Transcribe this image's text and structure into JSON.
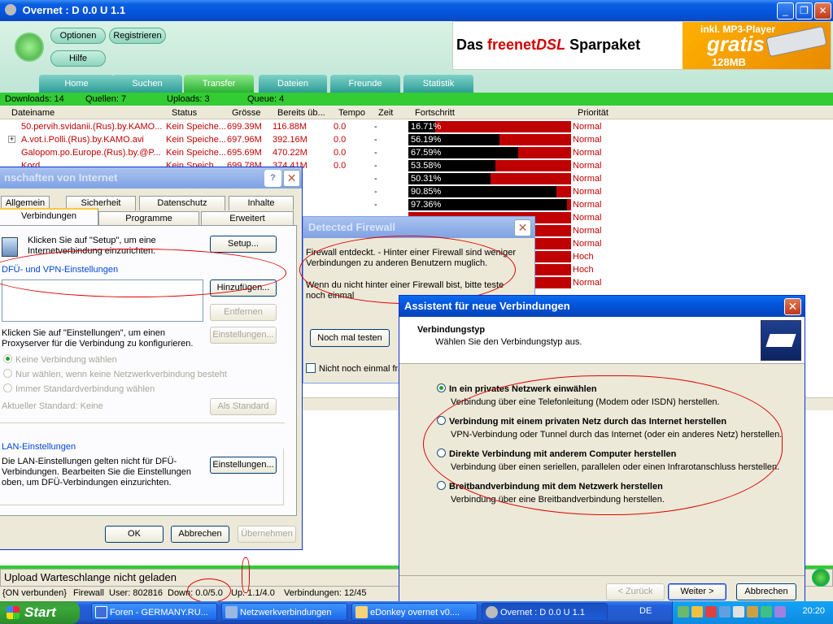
{
  "main_window": {
    "title": "Overnet : D 0.0 U 1.1",
    "buttons": {
      "options": "Optionen",
      "register": "Registrieren",
      "help": "Hilfe"
    },
    "banner": {
      "headline_pre": "Das ",
      "headline_brand": "freenet",
      "headline_brand2": "DSL",
      "headline_post": " Sparpaket",
      "promo_top": "inkl. MP3-Player",
      "promo_main": "gratis",
      "promo_sub": "128MB"
    },
    "nav": [
      "Home",
      "Suchen",
      "Transfer",
      "Dateien",
      "Freunde",
      "Statistik"
    ],
    "stats": {
      "downloads": "Downloads: 14",
      "sources": "Quellen: 7",
      "uploads": "Uploads: 3",
      "queue": "Queue: 4"
    },
    "columns": [
      "Dateiname",
      "Status",
      "Grösse",
      "Bereits üb...",
      "Tempo",
      "Zeit",
      "Fortschritt",
      "Priorität"
    ],
    "rows": [
      {
        "name": "50.pervih.svidanii.(Rus).by.KAMO...",
        "status": "Kein Speiche...",
        "size": "699.39M",
        "done": "116.88M",
        "speed": "0.0",
        "time": "-",
        "progress": "16.71%",
        "progress_value": 16.71,
        "priority": "Normal"
      },
      {
        "name": "A.vot.i.Polli.(Rus).by.KAMO.avi",
        "status": "Kein Speiche...",
        "size": "697.96M",
        "done": "392.16M",
        "speed": "0.0",
        "time": "-",
        "progress": "56.19%",
        "progress_value": 56.19,
        "priority": "Normal"
      },
      {
        "name": "Galopom.po.Europe.(Rus).by.@P...",
        "status": "Kein Speiche...",
        "size": "695.69M",
        "done": "470.22M",
        "speed": "0.0",
        "time": "-",
        "progress": "67.59%",
        "progress_value": 67.59,
        "priority": "Normal"
      },
      {
        "name": "Kord...",
        "status": "Kein Speich...",
        "size": "699.78M",
        "done": "374.41M",
        "speed": "0.0",
        "time": "-",
        "progress": "53.58%",
        "progress_value": 53.58,
        "priority": "Normal"
      },
      {
        "name": "",
        "status": "",
        "size": "",
        "done": "",
        "speed": "",
        "time": "-",
        "progress": "50.31%",
        "progress_value": 50.31,
        "priority": "Normal"
      },
      {
        "name": "",
        "status": "",
        "size": "",
        "done": "",
        "speed": "",
        "time": "-",
        "progress": "90.85%",
        "progress_value": 90.85,
        "priority": "Normal"
      },
      {
        "name": "",
        "status": "",
        "size": "",
        "done": "",
        "speed": "",
        "time": "-",
        "progress": "97.36%",
        "progress_value": 97.36,
        "priority": "Normal"
      },
      {
        "name": "",
        "status": "",
        "size": "",
        "done": "",
        "speed": "",
        "time": "",
        "progress": "",
        "progress_value": 0,
        "priority": "Normal"
      },
      {
        "name": "",
        "status": "",
        "size": "",
        "done": "",
        "speed": "",
        "time": "",
        "progress": "",
        "progress_value": 0,
        "priority": "Normal"
      },
      {
        "name": "",
        "status": "",
        "size": "",
        "done": "",
        "speed": "",
        "time": "",
        "progress": "",
        "progress_value": 0,
        "priority": "Normal"
      },
      {
        "name": "",
        "status": "",
        "size": "",
        "done": "",
        "speed": "",
        "time": "",
        "progress": "",
        "progress_value": 0,
        "priority": "Hoch"
      },
      {
        "name": "",
        "status": "",
        "size": "",
        "done": "",
        "speed": "",
        "time": "",
        "progress": "",
        "progress_value": 0,
        "priority": "Hoch"
      },
      {
        "name": "",
        "status": "",
        "size": "",
        "done": "",
        "speed": "",
        "time": "",
        "progress": "",
        "progress_value": 0,
        "priority": "Normal"
      }
    ],
    "upload_queue_msg": "Upload Warteschlange nicht geladen",
    "statusbar": [
      "{ON verbunden}",
      "Firewall",
      "User: 802816",
      "Down: 0.0/5.0",
      "Up: 1.1/4.0",
      "Verbindungen: 12/45"
    ]
  },
  "inet_dialog": {
    "title": "nschaften von Internet",
    "tabs_row1": [
      "Allgemein",
      "Sicherheit",
      "Datenschutz",
      "Inhalte"
    ],
    "tabs_row2": [
      "Verbindungen",
      "Programme",
      "Erweitert"
    ],
    "setup_text": "Klicken Sie auf \"Setup\", um eine Internetverbindung einzurichten.",
    "setup_btn": "Setup...",
    "dfue_header": "DFÜ- und VPN-Einstellungen",
    "add_btn": "Hinzufügen...",
    "remove_btn": "Entfernen",
    "settings_btn": "Einstellungen...",
    "proxy_text": "Klicken Sie auf \"Einstellungen\", um einen Proxyserver für die Verbindung zu konfigurieren.",
    "radio1": "Keine Verbindung wählen",
    "radio2": "Nur wählen, wenn keine Netzwerkverbindung besteht",
    "radio3": "Immer Standardverbindung wählen",
    "current_std": "Aktueller Standard:  Keine",
    "std_btn": "Als Standard",
    "lan_header": "LAN-Einstellungen",
    "lan_text": "Die LAN-Einstellungen gelten nicht für DFÜ-Verbindungen. Bearbeiten Sie die Einstellungen oben, um DFÜ-Verbindungen einzurichten.",
    "lan_btn": "Einstellungen...",
    "ok": "OK",
    "cancel": "Abbrechen",
    "apply": "Übernehmen"
  },
  "firewall_dialog": {
    "title": "Detected Firewall",
    "text1": "Firewall entdeckt. - Hinter einer Firewall sind weniger Verbindungen zu anderen Benutzern muglich.",
    "text2": "Wenn du nicht hinter einer Firewall bist, bitte teste noch einmal",
    "retest_btn": "Noch mal testen",
    "checkbox_label": "Nicht noch einmal fra"
  },
  "wizard": {
    "title": "Assistent für neue Verbindungen",
    "header": "Verbindungstyp",
    "subheader": "Wählen Sie den Verbindungstyp aus.",
    "options": [
      {
        "label": "In ein privates Netzwerk einwählen",
        "desc": "Verbindung über eine Telefonleitung (Modem oder ISDN) herstellen.",
        "selected": true
      },
      {
        "label": "Verbindung mit einem privaten Netz durch das Internet herstellen",
        "desc": "VPN-Verbindung oder Tunnel durch das Internet (oder ein anderes Netz) herstellen.",
        "selected": false
      },
      {
        "label": "Direkte Verbindung mit anderem Computer herstellen",
        "desc": "Verbindung über einen seriellen, parallelen oder einen Infrarotanschluss herstellen.",
        "selected": false
      },
      {
        "label": "Breitbandverbindung mit dem Netzwerk herstellen",
        "desc": "Verbindung über eine Breitbandverbindung herstellen.",
        "selected": false
      }
    ],
    "back": "< Zurück",
    "next": "Weiter >",
    "cancel": "Abbrechen"
  },
  "taskbar": {
    "start": "Start",
    "buttons": [
      "Foren - GERMANY.RU...",
      "Netzwerkverbindungen",
      "eDonkey overnet v0....",
      "Overnet : D 0.0 U 1.1"
    ],
    "lang": "DE",
    "clock": "20:20"
  },
  "colors": {
    "accent_green": "#33cc33",
    "xp_blue": "#0454dc",
    "annotation_red": "#e00000",
    "progress_red": "#c00000"
  }
}
